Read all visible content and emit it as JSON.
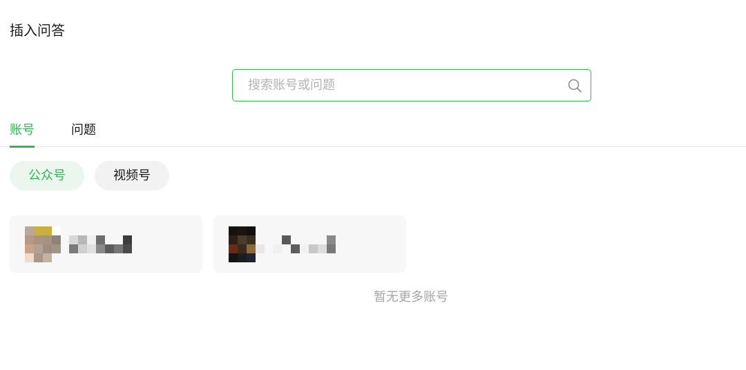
{
  "page": {
    "title": "插入问答"
  },
  "search": {
    "placeholder": "搜索账号或问题",
    "value": "",
    "icon": "search-icon",
    "border_color": "#2fb84f"
  },
  "tabs": [
    {
      "label": "账号",
      "active": true
    },
    {
      "label": "问题",
      "active": false
    }
  ],
  "filters": [
    {
      "label": "公众号",
      "active": true
    },
    {
      "label": "视频号",
      "active": false
    }
  ],
  "accounts": [
    {
      "avatar": "pixelated-avatar",
      "name_obscured": true
    },
    {
      "avatar": "pixelated-avatar",
      "name_obscured": true
    }
  ],
  "empty_state": {
    "text": "暂无更多账号"
  },
  "colors": {
    "accent": "#2fb84f",
    "accent_light_bg": "#ebf7ee",
    "card_bg": "#f7f7f7",
    "muted_text": "#a6a6a6"
  }
}
